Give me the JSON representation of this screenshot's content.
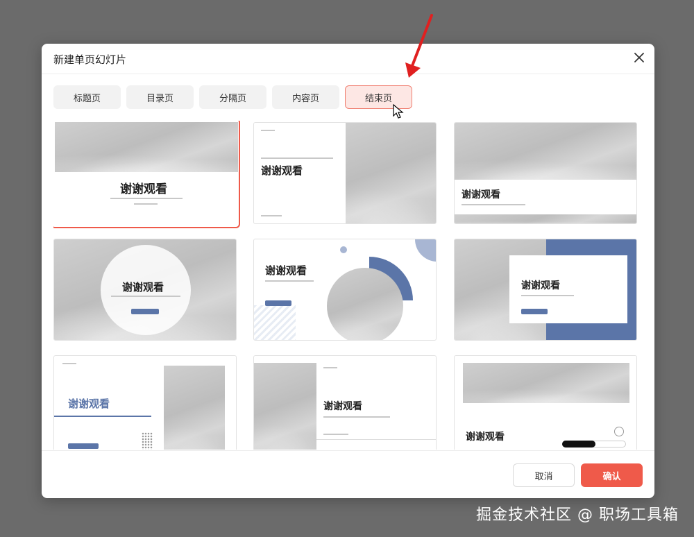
{
  "dialog": {
    "title": "新建单页幻灯片",
    "tabs": [
      {
        "label": "标题页",
        "active": false
      },
      {
        "label": "目录页",
        "active": false
      },
      {
        "label": "分隔页",
        "active": false
      },
      {
        "label": "内容页",
        "active": false
      },
      {
        "label": "结束页",
        "active": true
      }
    ],
    "cancel_label": "取消",
    "confirm_label": "确认"
  },
  "templates": {
    "thank_you_text": "谢谢观看"
  },
  "watermark": "掘金技术社区 @ 职场工具箱",
  "colors": {
    "accent": "#ef5a4a",
    "active_tab_bg": "#fde7e4",
    "template_blue": "#5b75a8",
    "overlay": "#6b6b6b"
  }
}
